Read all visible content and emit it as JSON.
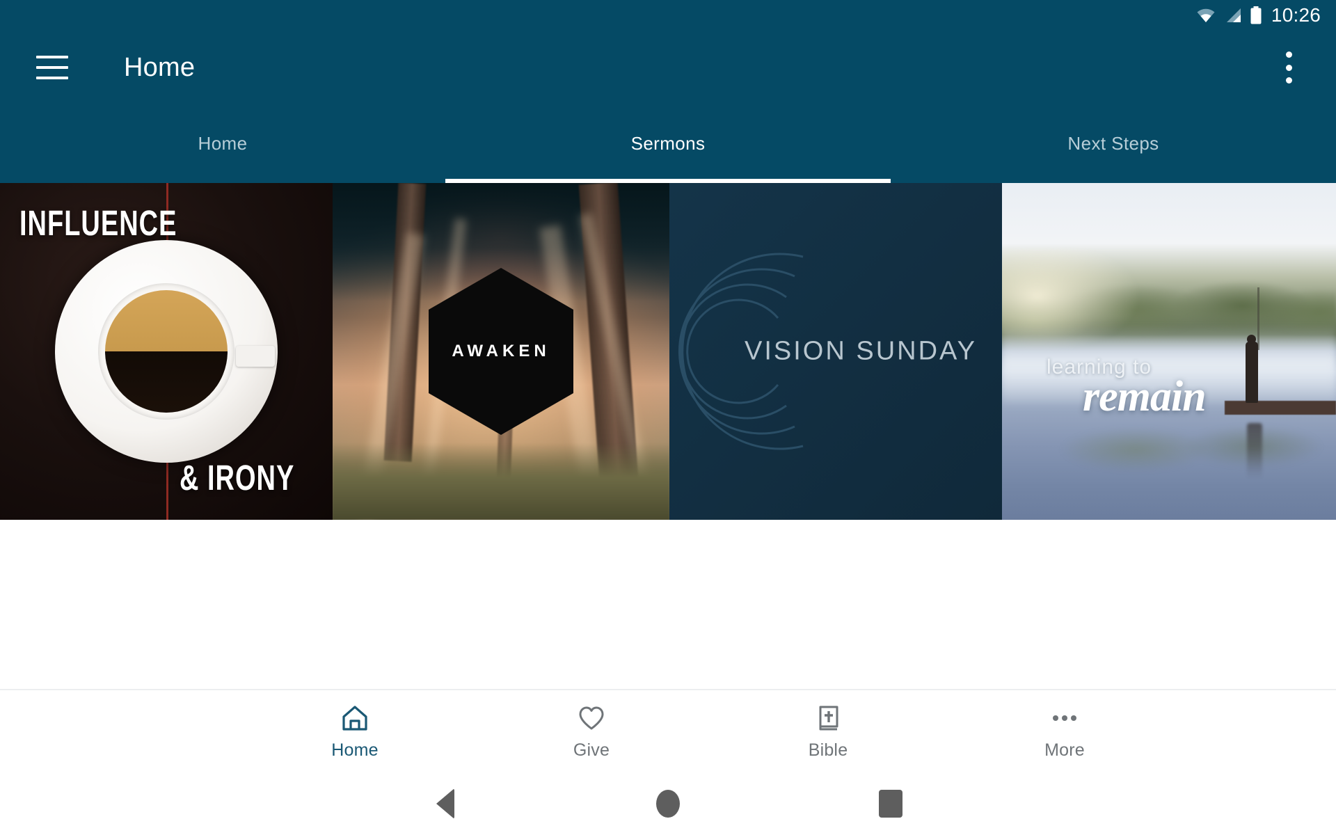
{
  "status_bar": {
    "wifi_icon": "wifi-icon",
    "signal_icon": "cellular-signal-icon",
    "battery_icon": "battery-full-icon",
    "time": "10:26"
  },
  "app_bar": {
    "menu_icon": "hamburger-menu-icon",
    "title": "Home",
    "overflow_icon": "overflow-menu-icon"
  },
  "tabs": [
    {
      "label": "Home",
      "active": false
    },
    {
      "label": "Sermons",
      "active": true
    },
    {
      "label": "Next Steps",
      "active": false
    }
  ],
  "sermon_cards": [
    {
      "name": "influence-and-irony",
      "title_top": "INFLUENCE",
      "title_bottom": "& IRONY",
      "artwork": "coffee-cup-on-saucer-dark-background"
    },
    {
      "name": "awaken",
      "title": "AWAKEN",
      "artwork": "sunlit-forest-with-black-hexagon"
    },
    {
      "name": "vision-sunday",
      "title": "VISION  SUNDAY",
      "artwork": "concentric-arcs-on-navy-background"
    },
    {
      "name": "learning-to-remain",
      "title_line1": "learning to",
      "title_line2": "remain",
      "artwork": "misty-lake-with-person-on-dock"
    }
  ],
  "bottom_nav": [
    {
      "label": "Home",
      "icon": "home-icon",
      "active": true
    },
    {
      "label": "Give",
      "icon": "heart-icon",
      "active": false
    },
    {
      "label": "Bible",
      "icon": "bible-book-icon",
      "active": false
    },
    {
      "label": "More",
      "icon": "more-dots-icon",
      "active": false
    }
  ],
  "system_nav": {
    "back": "back-triangle-icon",
    "home": "home-circle-icon",
    "recents": "recents-square-icon"
  },
  "colors": {
    "primary": "#054a65",
    "accent_active": "#1a5874",
    "tab_inactive": "#b7ced8",
    "nav_inactive": "#6f7478"
  }
}
